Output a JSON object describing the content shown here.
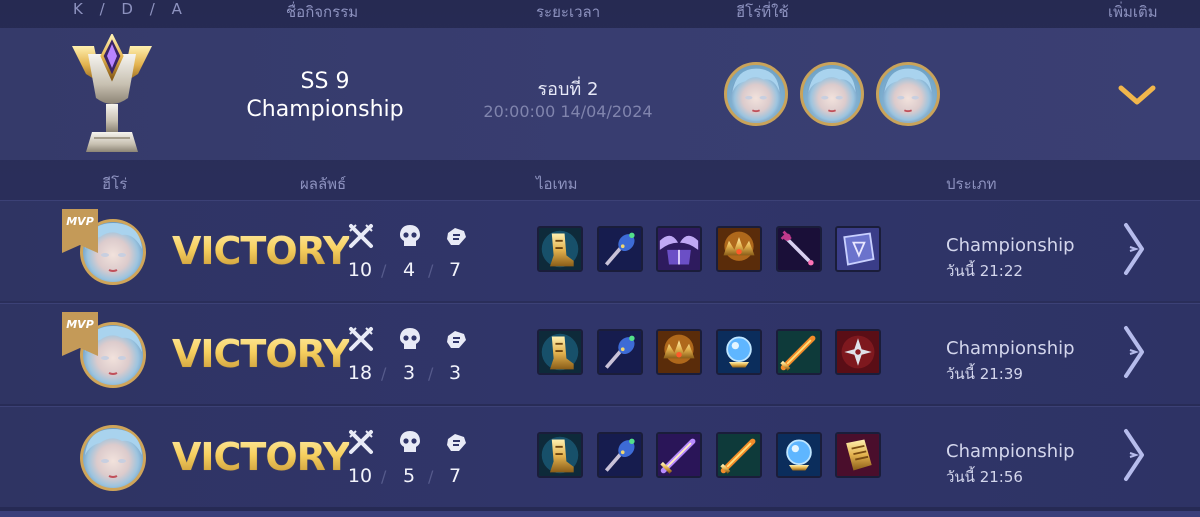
{
  "header": {
    "col_kda": "K / D / A",
    "col_activity": "ชื่อกิจกรรม",
    "col_time": "ระยะเวลา",
    "col_heroes": "ฮีโร่ที่ใช้",
    "col_more": "เพิ่มเติม"
  },
  "summary": {
    "event_line1": "SS 9",
    "event_line2": "Championship",
    "round_label": "รอบที่ 2",
    "round_time": "20:00:00 14/04/2024",
    "heroes_used": [
      "hero-portrait",
      "hero-portrait",
      "hero-portrait"
    ]
  },
  "columns": {
    "hero": "ฮีโร่",
    "result": "ผลลัพธ์",
    "items": "ไอเทม",
    "type": "ประเภท"
  },
  "matches": [
    {
      "mvp": true,
      "mvp_label": "MVP",
      "result": "VICTORY",
      "kills": "10",
      "deaths": "4",
      "assists": "7",
      "items": [
        "boots-item-icon",
        "potion-staff-item-icon",
        "winged-book-item-icon",
        "golden-crown-item-icon",
        "dagger-item-icon",
        "rune-tome-item-icon"
      ],
      "mode": "Championship",
      "date": "วันนี้ 21:22"
    },
    {
      "mvp": true,
      "mvp_label": "MVP",
      "result": "VICTORY",
      "kills": "18",
      "deaths": "3",
      "assists": "3",
      "items": [
        "boots-item-icon",
        "potion-staff-item-icon",
        "golden-crown-item-icon",
        "blue-orb-item-icon",
        "fire-blade-item-icon",
        "red-shuriken-item-icon"
      ],
      "mode": "Championship",
      "date": "วันนี้ 21:39"
    },
    {
      "mvp": false,
      "result": "VICTORY",
      "kills": "10",
      "deaths": "5",
      "assists": "7",
      "items": [
        "boots-item-icon",
        "potion-staff-item-icon",
        "purple-sword-item-icon",
        "fire-blade-item-icon",
        "blue-orb-item-icon",
        "golden-scroll-item-icon"
      ],
      "mode": "Championship",
      "date": "วันนี้ 21:56"
    }
  ],
  "colors": {
    "accent_gold": "#f4cf5f",
    "muted_label": "#8d92bf",
    "row_bg": "#30356a"
  }
}
